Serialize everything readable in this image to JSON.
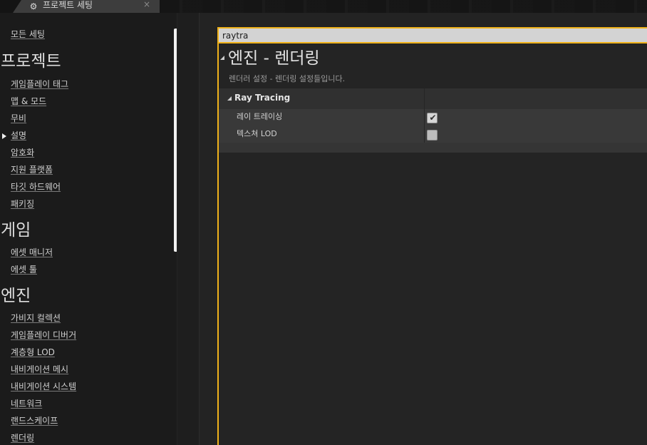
{
  "tab": {
    "title": "프로젝트 세팅",
    "icon": "gear-icon",
    "close_label": "×"
  },
  "sidebar": {
    "all_settings": "모든 세팅",
    "sections": [
      {
        "title": "프로젝트",
        "items": [
          "게임플레이 태그",
          "맵 & 모드",
          "무비",
          "설명",
          "암호화",
          "지원 플랫폼",
          "타깃 하드웨어",
          "패키징"
        ]
      },
      {
        "title": "게임",
        "items": [
          "에셋 매니저",
          "에셋 툴"
        ]
      },
      {
        "title": "엔진",
        "items": [
          "가비지 컬렉션",
          "게임플레이 디버거",
          "계층형 LOD",
          "내비게이션 메시",
          "내비게이션 시스템",
          "네트워크",
          "랜드스케이프",
          "렌더링"
        ]
      }
    ],
    "active_item": "설명"
  },
  "search": {
    "value": "raytra"
  },
  "category": {
    "title": "엔진 - 렌더링",
    "description": "렌더러 설정 - 렌더링 설정들입니다."
  },
  "ray_tracing": {
    "header": "Ray Tracing",
    "properties": [
      {
        "label": "레이 트레이싱",
        "checked": true
      },
      {
        "label": "텍스쳐 LOD",
        "checked": false
      }
    ]
  },
  "colors": {
    "accent": "#f0b21a"
  }
}
